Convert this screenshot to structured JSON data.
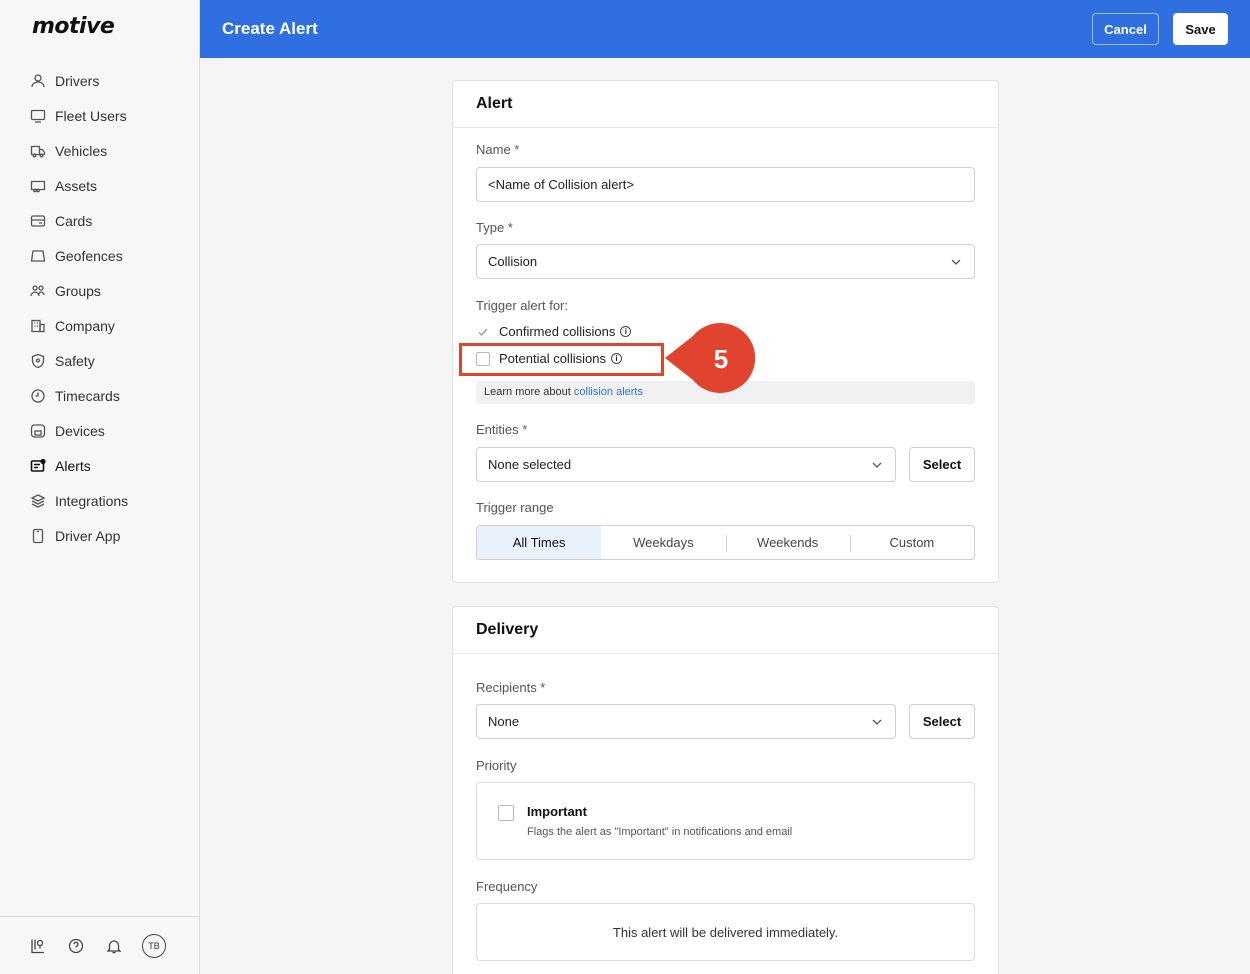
{
  "app": {
    "logo": "motive"
  },
  "sidebar": {
    "items": [
      {
        "label": "Drivers",
        "icon": "person-icon"
      },
      {
        "label": "Fleet Users",
        "icon": "monitor-icon"
      },
      {
        "label": "Vehicles",
        "icon": "truck-icon"
      },
      {
        "label": "Assets",
        "icon": "trailer-icon"
      },
      {
        "label": "Cards",
        "icon": "card-icon"
      },
      {
        "label": "Geofences",
        "icon": "geofence-icon"
      },
      {
        "label": "Groups",
        "icon": "groups-icon"
      },
      {
        "label": "Company",
        "icon": "building-icon"
      },
      {
        "label": "Safety",
        "icon": "shield-icon"
      },
      {
        "label": "Timecards",
        "icon": "clock-icon"
      },
      {
        "label": "Devices",
        "icon": "device-icon"
      },
      {
        "label": "Alerts",
        "icon": "alerts-icon"
      },
      {
        "label": "Integrations",
        "icon": "layers-icon"
      },
      {
        "label": "Driver App",
        "icon": "phone-icon"
      }
    ],
    "active": "Alerts",
    "footer": {
      "avatar_initials": "TB"
    }
  },
  "header": {
    "title": "Create Alert",
    "cancel_label": "Cancel",
    "save_label": "Save",
    "color": "#2f6fe0"
  },
  "alert_card": {
    "title": "Alert",
    "name_label": "Name *",
    "name_value": "<Name of Collision alert>",
    "type_label": "Type *",
    "type_value": "Collision",
    "trigger_label": "Trigger alert for:",
    "confirmed_label": "Confirmed collisions",
    "potential_label": "Potential collisions",
    "learn_prefix": "Learn more about",
    "learn_link": "collision alerts",
    "entities_label": "Entities *",
    "entities_value": "None selected",
    "select_label": "Select",
    "range_label": "Trigger range",
    "range_options": [
      "All Times",
      "Weekdays",
      "Weekends",
      "Custom"
    ],
    "range_selected": "All Times"
  },
  "delivery_card": {
    "title": "Delivery",
    "recipients_label": "Recipients *",
    "recipients_value": "None",
    "select_label": "Select",
    "priority_label": "Priority",
    "important_title": "Important",
    "important_desc": "Flags the alert as \"Important\" in notifications and email",
    "frequency_label": "Frequency",
    "frequency_text": "This alert will be delivered immediately."
  },
  "annotation": {
    "step": "5",
    "color": "#e0442f"
  }
}
